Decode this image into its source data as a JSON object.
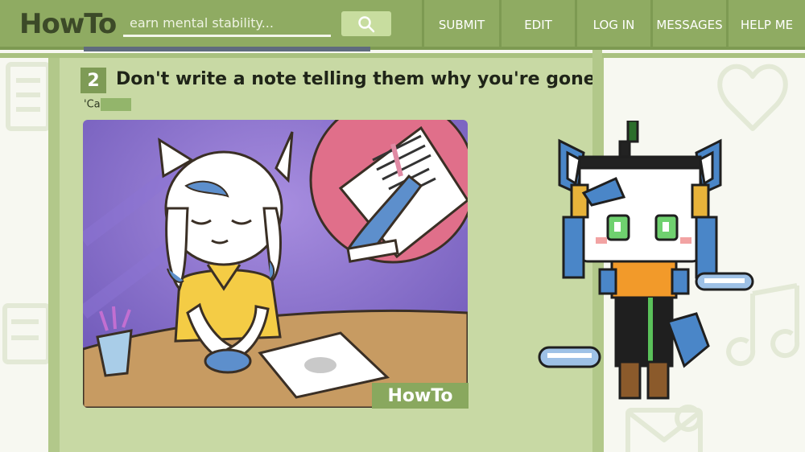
{
  "header": {
    "logo": "HowTo",
    "search_placeholder": "earn mental stability...",
    "nav": [
      {
        "label": "SUBMIT"
      },
      {
        "label": "EDIT"
      },
      {
        "label": "LOG IN"
      },
      {
        "label": "MESSAGES"
      },
      {
        "label": "HELP ME"
      }
    ]
  },
  "step": {
    "number": "2",
    "title": "Don't write a note telling them why you're gone.",
    "subtitle": "'Ca"
  },
  "illustration": {
    "watermark": "HowTo"
  },
  "colors": {
    "accent": "#8fab62",
    "panel": "#c8d9a4",
    "border": "#b2c88a"
  }
}
